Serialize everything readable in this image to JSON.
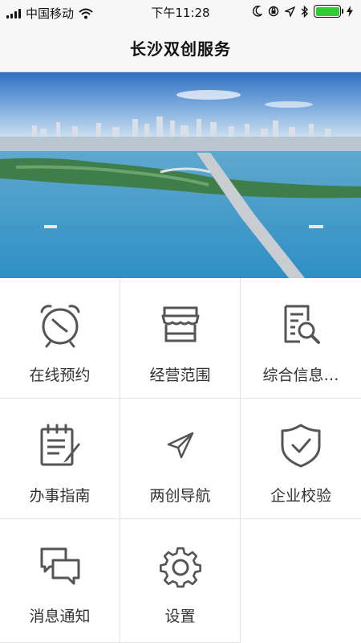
{
  "status_bar": {
    "carrier": "中国移动",
    "time": "下午11:28"
  },
  "header": {
    "title": "长沙双创服务"
  },
  "menu": [
    {
      "label": "在线预约",
      "icon": "alarm-clock-icon"
    },
    {
      "label": "经营范围",
      "icon": "storefront-icon"
    },
    {
      "label": "综合信息…",
      "icon": "document-search-icon"
    },
    {
      "label": "办事指南",
      "icon": "notepad-pen-icon"
    },
    {
      "label": "两创导航",
      "icon": "paper-plane-icon"
    },
    {
      "label": "企业校验",
      "icon": "shield-check-icon"
    },
    {
      "label": "消息通知",
      "icon": "chat-bubbles-icon"
    },
    {
      "label": "设置",
      "icon": "gear-icon"
    }
  ],
  "colors": {
    "icon_stroke": "#555555",
    "battery": "#37c837"
  }
}
